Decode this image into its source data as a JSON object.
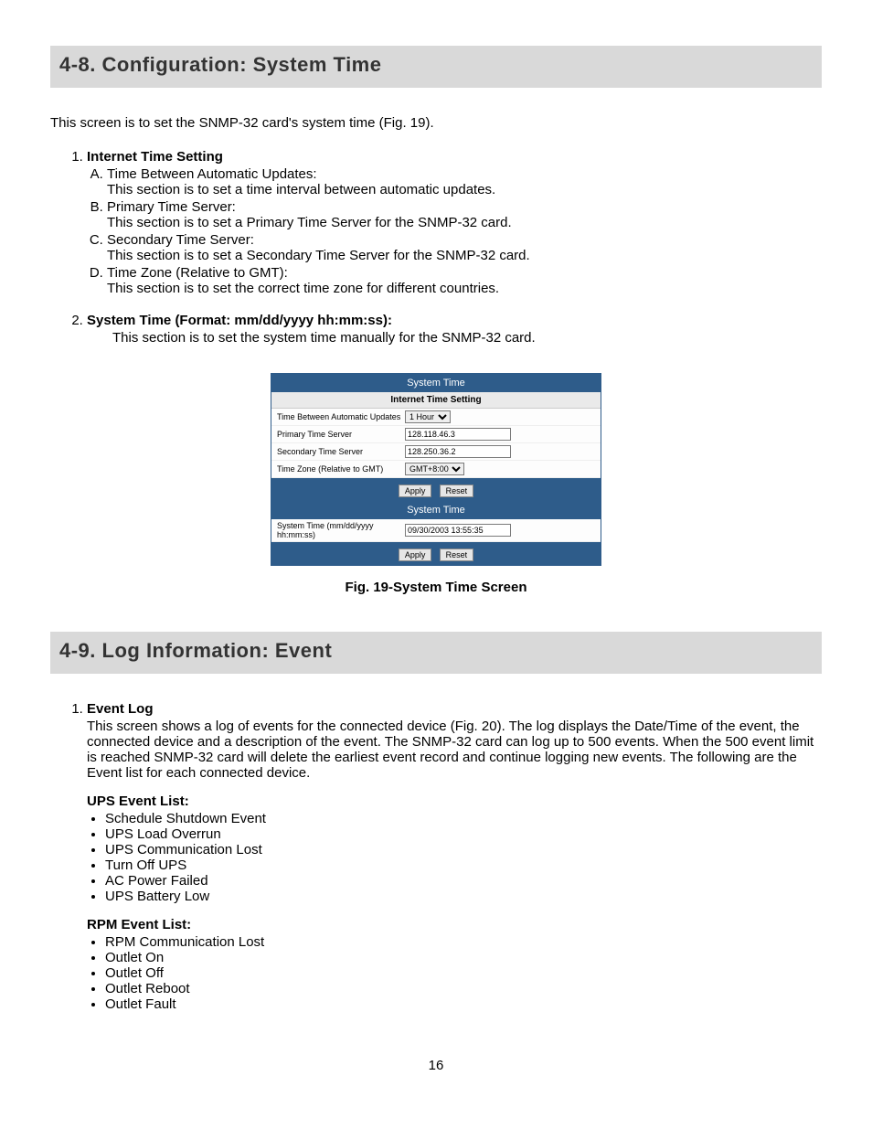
{
  "section48": {
    "heading": "4-8.  Configuration: System Time",
    "intro": "This screen is to set the SNMP-32 card's system time (Fig. 19).",
    "list": [
      {
        "title": "Internet Time Setting",
        "sub": [
          {
            "head": "Time Between Automatic Updates:",
            "body": "This section is to set a time interval between automatic updates."
          },
          {
            "head": "Primary Time Server:",
            "body": "This section is to set a Primary Time Server for the SNMP-32 card."
          },
          {
            "head": "Secondary Time Server:",
            "body": "This section is to set a Secondary Time Server for the SNMP-32 card."
          },
          {
            "head": "Time Zone (Relative to GMT):",
            "body": "This section is to set the correct time zone for different countries."
          }
        ]
      },
      {
        "title": "System Time (Format:  mm/dd/yyyy hh:mm:ss):",
        "body": "This section is to set the system time manually for the SNMP-32 card."
      }
    ]
  },
  "figure": {
    "header1": "System Time",
    "subheader1": "Internet Time Setting",
    "rows": {
      "interval_label": "Time Between Automatic Updates",
      "interval_value": "1 Hour",
      "primary_label": "Primary Time Server",
      "primary_value": "128.118.46.3",
      "secondary_label": "Secondary Time Server",
      "secondary_value": "128.250.36.2",
      "tz_label": "Time Zone (Relative to GMT)",
      "tz_value": "GMT+8:00"
    },
    "apply_label": "Apply",
    "reset_label": "Reset",
    "header2": "System Time",
    "systime_label": "System Time (mm/dd/yyyy hh:mm:ss)",
    "systime_value": "09/30/2003 13:55:35",
    "caption": "Fig. 19-System Time Screen"
  },
  "section49": {
    "heading": "4-9.  Log Information: Event",
    "event_log_title": "Event Log",
    "event_log_body": "This screen shows a log of events for the connected device (Fig. 20).  The log displays the Date/Time of the event, the connected device and a description of the event.  The SNMP-32 card can log up to 500 events.  When the 500 event limit is reached SNMP-32 card will delete the earliest event record and continue logging new events.  The following are the Event list for each connected device.",
    "ups_title": "UPS Event List:",
    "ups_items": [
      "Schedule Shutdown Event",
      "UPS Load Overrun",
      "UPS Communication Lost",
      "Turn Off UPS",
      "AC Power Failed",
      "UPS Battery Low"
    ],
    "rpm_title": "RPM Event List:",
    "rpm_items": [
      "RPM Communication Lost",
      "Outlet On",
      "Outlet Off",
      "Outlet Reboot",
      "Outlet Fault"
    ]
  },
  "page_number": "16"
}
